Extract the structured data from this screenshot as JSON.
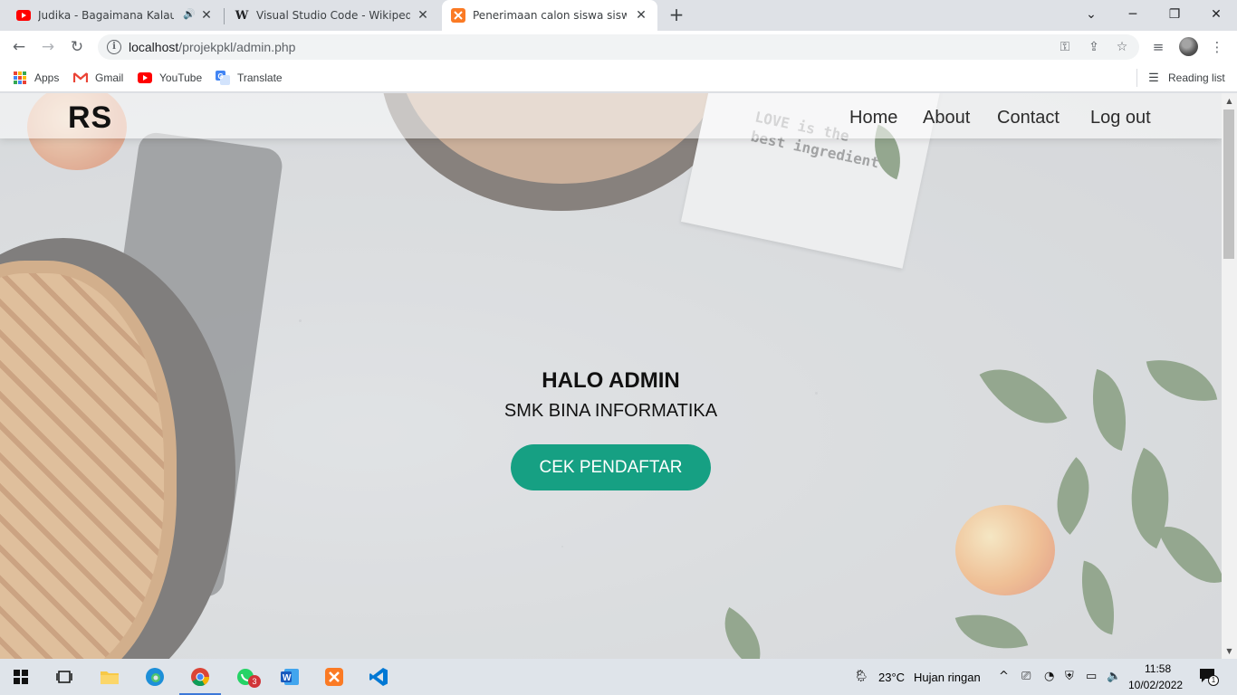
{
  "browser": {
    "tabs": [
      {
        "title": "Judika - Bagaimana Kalau Aku",
        "icon": "youtube-icon",
        "audio": true
      },
      {
        "title": "Visual Studio Code - Wikipedia b",
        "icon": "wikipedia-icon",
        "audio": false
      },
      {
        "title": "Penerimaan calon siswa siswi",
        "icon": "xampp-icon",
        "audio": false,
        "active": true
      }
    ],
    "new_tab": "+",
    "url_host": "localhost",
    "url_path": "/projekpkl/admin.php",
    "bookmarks": [
      "Apps",
      "Gmail",
      "YouTube",
      "Translate"
    ],
    "reading_list": "Reading list"
  },
  "site": {
    "logo": "RS",
    "nav": [
      "Home",
      "About",
      "Contact",
      "Log out"
    ],
    "hero_title": "HALO ADMIN",
    "hero_subtitle": "SMK BINA INFORMATIKA",
    "hero_button": "CEK PENDAFTAR",
    "napkin_line1": "LOVE is the",
    "napkin_line2": "best ingredient",
    "accent_color": "#16a083"
  },
  "taskbar": {
    "weather_temp": "23°C",
    "weather_desc": "Hujan ringan",
    "time": "11:58",
    "date": "10/02/2022",
    "whatsapp_badge": "3",
    "notification_count": "1"
  }
}
